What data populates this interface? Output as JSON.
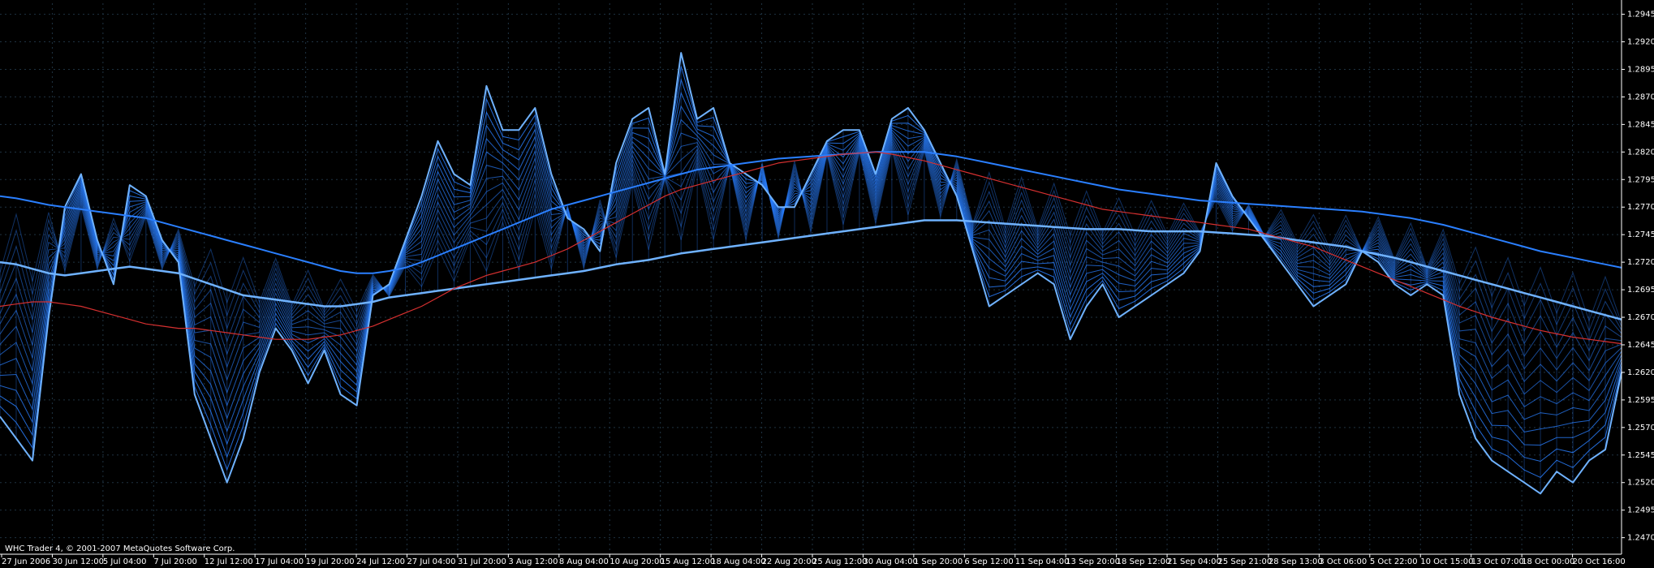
{
  "footer": {
    "copyright": "WHC Trader 4, © 2001-2007 MetaQuotes Software Corp."
  },
  "colors": {
    "background": "#000000",
    "axis": "#ffffff",
    "grid": "#1f3342",
    "ribbon": "#2a7fff",
    "ribbon_light": "#6fb2ff",
    "signal": "#d63030"
  },
  "chart_data": {
    "type": "line",
    "ylim": [
      1.2455,
      1.2955
    ],
    "y_ticks": [
      1.2945,
      1.292,
      1.2895,
      1.287,
      1.2845,
      1.282,
      1.2795,
      1.277,
      1.2745,
      1.272,
      1.2695,
      1.267,
      1.2645,
      1.262,
      1.2595,
      1.257,
      1.2545,
      1.252,
      1.2495,
      1.247
    ],
    "y_tick_labels": [
      "1.2945",
      "1.2920",
      "1.2895",
      "1.2870",
      "1.2845",
      "1.2820",
      "1.2795",
      "1.2770",
      "1.2745",
      "1.2720",
      "1.2695",
      "1.2670",
      "1.2645",
      "1.2620",
      "1.2595",
      "1.2570",
      "1.2545",
      "1.2520",
      "1.2495",
      "1.2470"
    ],
    "x_tick_labels": [
      "27 Jun 2006",
      "30 Jun 12:00",
      "5 Jul 04:00",
      "7 Jul 20:00",
      "12 Jul 12:00",
      "17 Jul 04:00",
      "19 Jul 20:00",
      "24 Jul 12:00",
      "27 Jul 04:00",
      "31 Jul 20:00",
      "3 Aug 12:00",
      "8 Aug 04:00",
      "10 Aug 20:00",
      "15 Aug 12:00",
      "18 Aug 04:00",
      "22 Aug 20:00",
      "25 Aug 12:00",
      "30 Aug 04:00",
      "1 Sep 20:00",
      "6 Sep 12:00",
      "11 Sep 04:00",
      "13 Sep 20:00",
      "18 Sep 12:00",
      "21 Sep 04:00",
      "25 Sep 21:00",
      "28 Sep 13:00",
      "3 Oct 06:00",
      "5 Oct 22:00",
      "10 Oct 15:00",
      "13 Oct 07:00",
      "18 Oct 00:00",
      "20 Oct 16:00"
    ],
    "grid": true,
    "series": [
      {
        "values": [
          1.258,
          1.256,
          1.254,
          1.267,
          1.277,
          1.28,
          1.274,
          1.27,
          1.279,
          1.278,
          1.274,
          1.272,
          1.26,
          1.256,
          1.252,
          1.256,
          1.262,
          1.266,
          1.264,
          1.261,
          1.264,
          1.26,
          1.259,
          1.269,
          1.27,
          1.274,
          1.278,
          1.283,
          1.28,
          1.279,
          1.288,
          1.284,
          1.284,
          1.286,
          1.28,
          1.276,
          1.275,
          1.273,
          1.281,
          1.285,
          1.286,
          1.28,
          1.291,
          1.285,
          1.286,
          1.281,
          1.28,
          1.279,
          1.277,
          1.277,
          1.28,
          1.283,
          1.284,
          1.284,
          1.28,
          1.285,
          1.286,
          1.284,
          1.281,
          1.278,
          1.273,
          1.268,
          1.269,
          1.27,
          1.271,
          1.27,
          1.265,
          1.268,
          1.27,
          1.267,
          1.268,
          1.269,
          1.27,
          1.271,
          1.273,
          1.281,
          1.278,
          1.276,
          1.274,
          1.272,
          1.27,
          1.268,
          1.269,
          1.27,
          1.273,
          1.272,
          1.27,
          1.269,
          1.27,
          1.269,
          1.26,
          1.256,
          1.254,
          1.253,
          1.252,
          1.251,
          1.253,
          1.252,
          1.254,
          1.255,
          1.262
        ]
      },
      {
        "values": [
          1.272,
          1.2718,
          1.2714,
          1.271,
          1.2708,
          1.271,
          1.2712,
          1.2714,
          1.2716,
          1.2714,
          1.2712,
          1.271,
          1.2705,
          1.27,
          1.2695,
          1.269,
          1.2688,
          1.2686,
          1.2684,
          1.2682,
          1.268,
          1.268,
          1.2682,
          1.2684,
          1.2688,
          1.269,
          1.2692,
          1.2694,
          1.2696,
          1.2698,
          1.27,
          1.2702,
          1.2704,
          1.2706,
          1.2708,
          1.271,
          1.2712,
          1.2715,
          1.2718,
          1.272,
          1.2722,
          1.2725,
          1.2728,
          1.273,
          1.2732,
          1.2734,
          1.2736,
          1.2738,
          1.274,
          1.2742,
          1.2744,
          1.2746,
          1.2748,
          1.275,
          1.2752,
          1.2754,
          1.2756,
          1.2758,
          1.2758,
          1.2758,
          1.2757,
          1.2756,
          1.2755,
          1.2754,
          1.2753,
          1.2752,
          1.2751,
          1.275,
          1.275,
          1.275,
          1.2749,
          1.2748,
          1.2748,
          1.2748,
          1.2748,
          1.2747,
          1.2746,
          1.2745,
          1.2744,
          1.2742,
          1.274,
          1.2738,
          1.2736,
          1.2734,
          1.273,
          1.2727,
          1.2724,
          1.272,
          1.2716,
          1.2712,
          1.2708,
          1.2704,
          1.27,
          1.2696,
          1.2692,
          1.2688,
          1.2684,
          1.268,
          1.2676,
          1.2672,
          1.2668
        ]
      },
      {
        "values": [
          1.278,
          1.2778,
          1.2775,
          1.2772,
          1.277,
          1.2768,
          1.2766,
          1.2764,
          1.2762,
          1.276,
          1.2756,
          1.2752,
          1.2748,
          1.2744,
          1.274,
          1.2736,
          1.2732,
          1.2728,
          1.2724,
          1.272,
          1.2716,
          1.2712,
          1.271,
          1.271,
          1.2712,
          1.2715,
          1.272,
          1.2726,
          1.2732,
          1.2738,
          1.2744,
          1.275,
          1.2756,
          1.2762,
          1.2768,
          1.2772,
          1.2776,
          1.278,
          1.2784,
          1.2788,
          1.2792,
          1.2796,
          1.28,
          1.2804,
          1.2806,
          1.2808,
          1.281,
          1.2812,
          1.2814,
          1.2815,
          1.2816,
          1.2817,
          1.2818,
          1.2819,
          1.282,
          1.282,
          1.282,
          1.282,
          1.2818,
          1.2816,
          1.2813,
          1.281,
          1.2807,
          1.2804,
          1.2801,
          1.2798,
          1.2795,
          1.2792,
          1.2789,
          1.2786,
          1.2784,
          1.2782,
          1.278,
          1.2778,
          1.2776,
          1.2775,
          1.2774,
          1.2773,
          1.2772,
          1.2771,
          1.277,
          1.2769,
          1.2768,
          1.2767,
          1.2766,
          1.2764,
          1.2762,
          1.276,
          1.2757,
          1.2754,
          1.275,
          1.2746,
          1.2742,
          1.2738,
          1.2734,
          1.273,
          1.2727,
          1.2724,
          1.2721,
          1.2718,
          1.2715
        ]
      },
      {
        "values": [
          1.268,
          1.2682,
          1.2684,
          1.2684,
          1.2682,
          1.268,
          1.2676,
          1.2672,
          1.2668,
          1.2664,
          1.2662,
          1.266,
          1.266,
          1.2658,
          1.2656,
          1.2654,
          1.2652,
          1.265,
          1.265,
          1.265,
          1.2652,
          1.2654,
          1.2658,
          1.2662,
          1.2668,
          1.2674,
          1.268,
          1.2688,
          1.2696,
          1.2702,
          1.2708,
          1.2712,
          1.2716,
          1.272,
          1.2726,
          1.2732,
          1.274,
          1.2748,
          1.2756,
          1.2764,
          1.2772,
          1.278,
          1.2786,
          1.279,
          1.2794,
          1.2798,
          1.2802,
          1.2806,
          1.281,
          1.2812,
          1.2814,
          1.2816,
          1.2818,
          1.2819,
          1.282,
          1.2818,
          1.2815,
          1.2812,
          1.2808,
          1.2804,
          1.28,
          1.2796,
          1.2792,
          1.2788,
          1.2784,
          1.278,
          1.2776,
          1.2772,
          1.2768,
          1.2766,
          1.2764,
          1.2762,
          1.276,
          1.2758,
          1.2756,
          1.2754,
          1.2752,
          1.275,
          1.2746,
          1.2742,
          1.2738,
          1.2734,
          1.2728,
          1.2722,
          1.2716,
          1.271,
          1.2704,
          1.2698,
          1.2692,
          1.2686,
          1.268,
          1.2675,
          1.267,
          1.2666,
          1.2662,
          1.2658,
          1.2655,
          1.2652,
          1.265,
          1.2648,
          1.2646
        ]
      }
    ]
  }
}
